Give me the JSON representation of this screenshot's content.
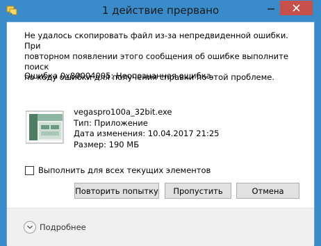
{
  "window": {
    "title": "1 действие прервано"
  },
  "message": {
    "line1": "Не удалось скопировать файл из-за непредвиденной ошибки. При",
    "line2": "повторном появлении этого сообщения об ошибке выполните поиск",
    "line3": "по коду ошибки для получения справки по этой проблеме.",
    "error": "Ошибка 0x80004005: Неопознанная ошибка"
  },
  "file": {
    "name": "vegaspro100a_32bit.exe",
    "type": "Тип: Приложение",
    "modified": "Дата изменения: 10.04.2017 21:25",
    "size": "Размер: 190 МБ"
  },
  "checkbox": {
    "label": "Выполнить для всех текущих элементов",
    "checked": false
  },
  "buttons": {
    "retry": "Повторить попытку",
    "skip": "Пропустить",
    "cancel": "Отмена"
  },
  "footer": {
    "more": "Подробнее"
  },
  "icons": {
    "app": "copy-icon",
    "minimize": "minimize-icon",
    "close": "close-icon",
    "expand": "chevron-down-icon"
  }
}
